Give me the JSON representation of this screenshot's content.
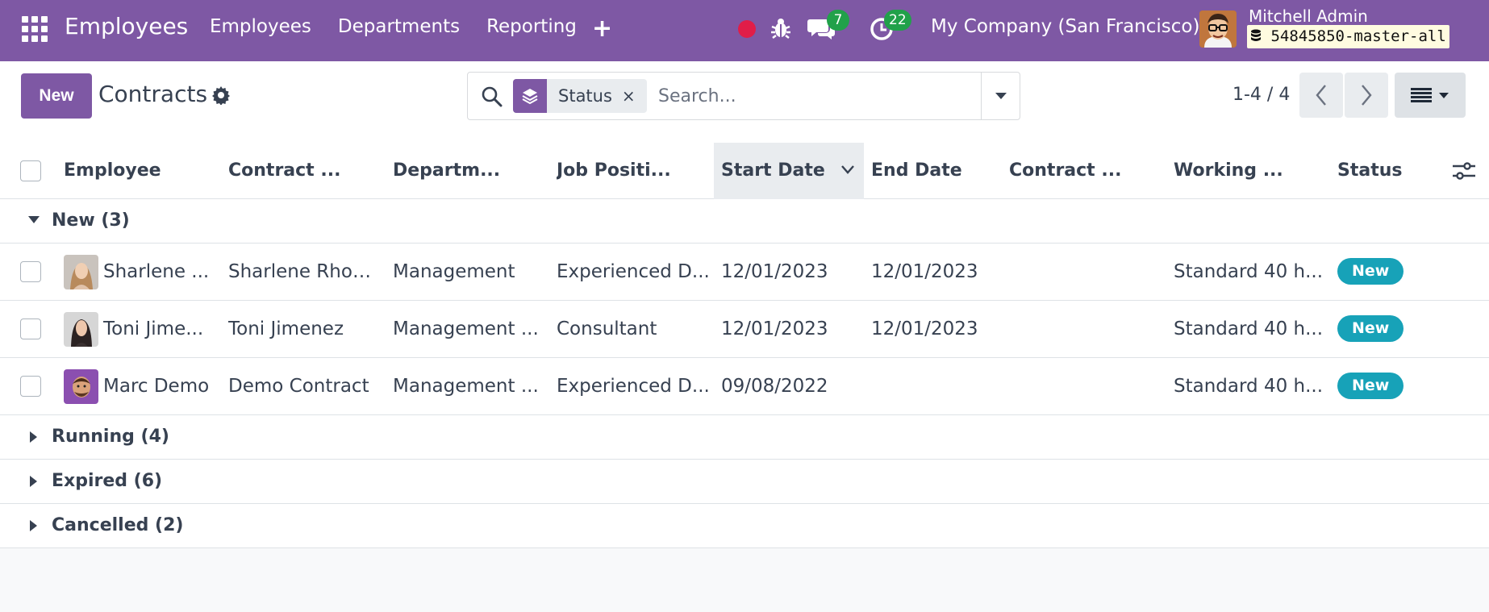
{
  "navbar": {
    "brand": "Employees",
    "menu": [
      "Employees",
      "Departments",
      "Reporting"
    ],
    "plus_symbol": "+",
    "messages_count": "7",
    "activities_count": "22",
    "company": "My Company (San Francisco)",
    "user_name": "Mitchell Admin",
    "database": "54845850-master-all",
    "icons": [
      "apps-grid-icon",
      "plus-icon",
      "record-icon",
      "bug-icon",
      "chat-icon",
      "clock-icon",
      "database-icon"
    ],
    "accent_color": "#7e58a4"
  },
  "control_panel": {
    "new_label": "New",
    "title": "Contracts",
    "facet_label": "Status",
    "facet_close": "×",
    "search_placeholder": "Search...",
    "pager": "1-4 / 4"
  },
  "table": {
    "columns": [
      "Employee",
      "Contract ...",
      "Departm...",
      "Job Positi...",
      "Start Date",
      "End Date",
      "Contract ...",
      "Working ...",
      "Status"
    ],
    "sorted_column": "Start Date",
    "groups": [
      {
        "label": "New (3)",
        "expanded": true,
        "rows": [
          {
            "employee": "Sharlene ...",
            "contract": "Sharlene Rhod...",
            "department": "Management",
            "job": "Experienced D...",
            "start": "12/01/2023",
            "end": "12/01/2023",
            "contract_type": "",
            "working": "Standard 40 h...",
            "status": "New"
          },
          {
            "employee": "Toni Jime...",
            "contract": "Toni Jimenez",
            "department": "Management ...",
            "job": "Consultant",
            "start": "12/01/2023",
            "end": "12/01/2023",
            "contract_type": "",
            "working": "Standard 40 h...",
            "status": "New"
          },
          {
            "employee": "Marc Demo",
            "contract": "Demo Contract",
            "department": "Management ...",
            "job": "Experienced D...",
            "start": "09/08/2022",
            "end": "",
            "contract_type": "",
            "working": "Standard 40 h...",
            "status": "New"
          }
        ]
      },
      {
        "label": "Running (4)",
        "expanded": false
      },
      {
        "label": "Expired (6)",
        "expanded": false
      },
      {
        "label": "Cancelled (2)",
        "expanded": false
      }
    ],
    "status_color": "#17a2b8"
  }
}
